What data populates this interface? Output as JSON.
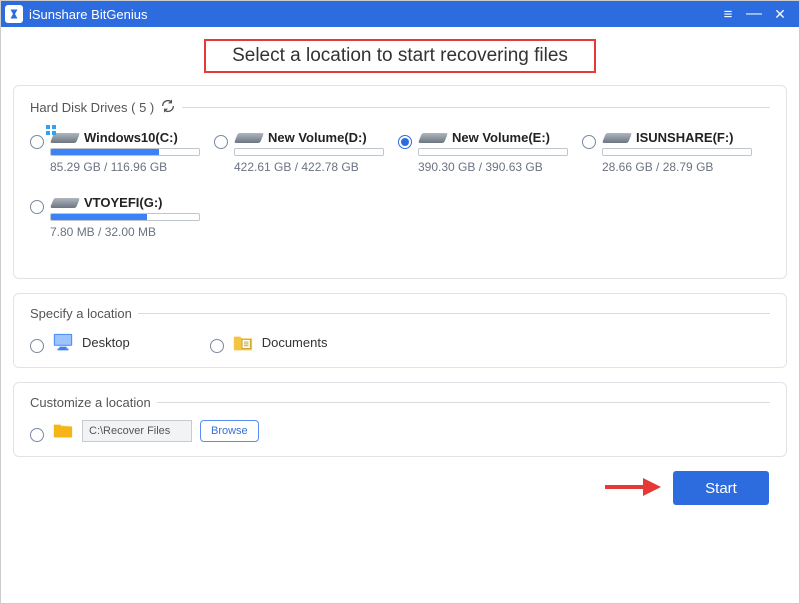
{
  "titlebar": {
    "app_name": "iSunshare BitGenius"
  },
  "headline": "Select a location to start recovering files",
  "hdd": {
    "heading": "Hard Disk Drives ( 5 )",
    "drives": [
      {
        "name": "Windows10(C:)",
        "size": "85.29 GB / 116.96 GB",
        "pct": 73,
        "selected": false,
        "win": true
      },
      {
        "name": "New Volume(D:)",
        "size": "422.61 GB / 422.78 GB",
        "pct": 0,
        "selected": false,
        "win": false
      },
      {
        "name": "New Volume(E:)",
        "size": "390.30 GB / 390.63 GB",
        "pct": 0,
        "selected": true,
        "win": false
      },
      {
        "name": "ISUNSHARE(F:)",
        "size": "28.66 GB / 28.79 GB",
        "pct": 0,
        "selected": false,
        "win": false
      },
      {
        "name": "VTOYEFI(G:)",
        "size": "7.80 MB / 32.00 MB",
        "pct": 65,
        "selected": false,
        "win": false
      }
    ]
  },
  "specify": {
    "heading": "Specify a location",
    "items": [
      {
        "key": "desktop",
        "label": "Desktop"
      },
      {
        "key": "documents",
        "label": "Documents"
      }
    ]
  },
  "customize": {
    "heading": "Customize a location",
    "path_value": "C:\\Recover Files",
    "browse_label": "Browse"
  },
  "footer": {
    "start_label": "Start"
  }
}
